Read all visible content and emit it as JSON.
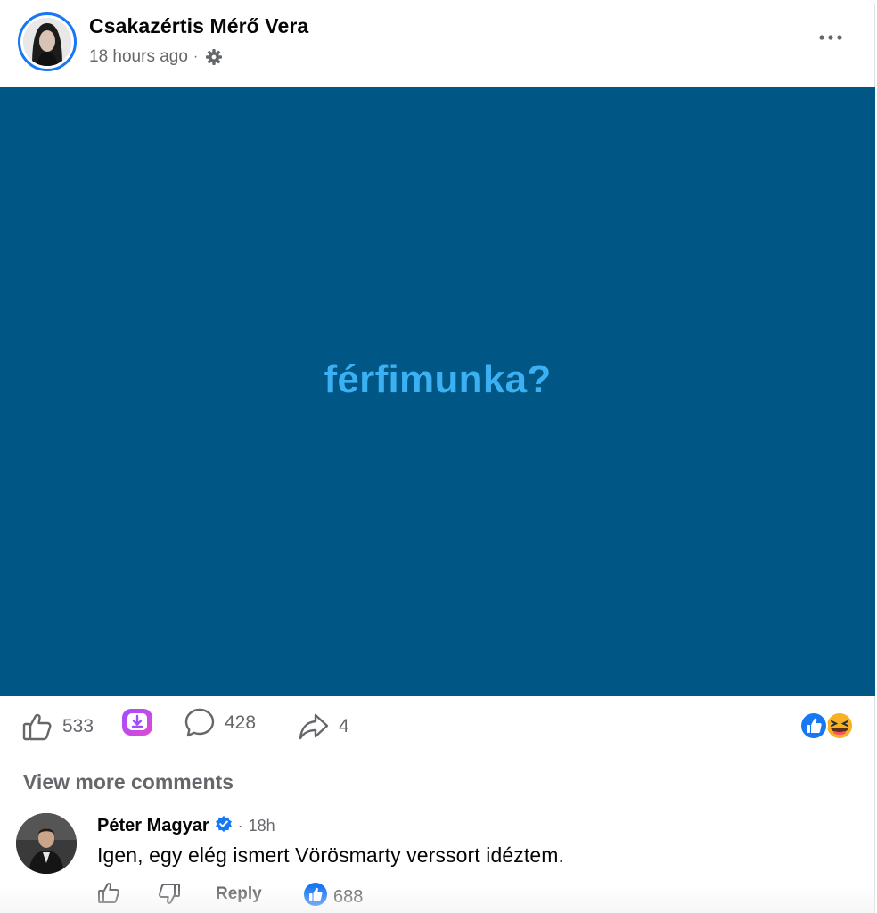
{
  "post": {
    "author": "Csakazértis Mérő Vera",
    "time": "18 hours ago",
    "separator": "·",
    "privacy_icon": "gear-icon",
    "image_text": "férfimunka?",
    "image_bg_color": "#005685",
    "image_text_color": "#3bb0f2"
  },
  "actions": {
    "like_count": "533",
    "comment_count": "428",
    "share_count": "4",
    "reaction_icons": [
      "like-reaction-icon",
      "haha-reaction-icon"
    ]
  },
  "comments": {
    "view_more": "View more comments",
    "items": [
      {
        "author": "Péter Magyar",
        "verified": true,
        "separator": "·",
        "time": "18h",
        "text": "Igen, egy elég ismert Vörösmarty verssort idéztem.",
        "reply_label": "Reply",
        "likes": "688"
      }
    ]
  },
  "colors": {
    "accent": "#1877f2",
    "secondary_text": "#65676b"
  }
}
